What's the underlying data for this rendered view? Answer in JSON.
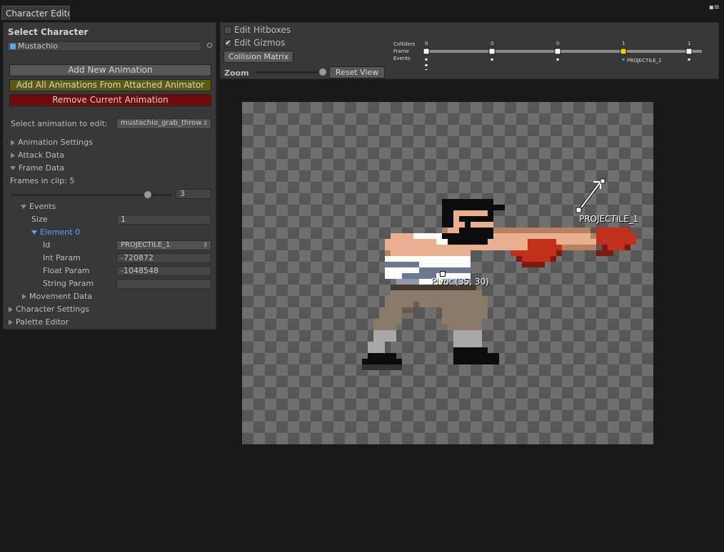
{
  "window": {
    "tab_label": "Character Edito",
    "menu_glyph": "▪≡"
  },
  "left": {
    "select_character_heading": "Select Character",
    "character_field": "Mustachio",
    "buttons": {
      "add_new": "Add New Animation",
      "add_all": "Add All Animations From Attached Animator",
      "remove": "Remove Current Animation"
    },
    "colors": {
      "add_all_bg": "#5a5a10",
      "remove_bg": "#6e0b0b"
    },
    "select_anim_label": "Select animation to edit:",
    "select_anim_value": "mustachio_grab_throw",
    "sections": {
      "animation_settings": "Animation Settings",
      "attack_data": "Attack Data",
      "frame_data": "Frame Data"
    },
    "frames_in_clip": "Frames in clip: 5",
    "frame_slider": {
      "value": "3",
      "fraction": 0.85
    },
    "events": {
      "label": "Events",
      "size_label": "Size",
      "size_value": "1",
      "element_label": "Element 0",
      "id_label": "Id",
      "id_value": "PROJECTILE_1",
      "int_label": "Int Param",
      "int_value": "-720872",
      "float_label": "Float Param",
      "float_value": "-1048548",
      "string_label": "String Param",
      "string_value": ""
    },
    "movement_data": "Movement Data",
    "character_settings": "Character Settings",
    "palette_editor": "Palette Editor"
  },
  "top": {
    "edit_hitboxes": "Edit Hitboxes",
    "edit_hitboxes_checked": false,
    "edit_gizmos": "Edit Gizmos",
    "edit_gizmos_checked": true,
    "collision_matrix": "Collision Matrix",
    "zoom_label": "Zoom",
    "zoom_fraction": 0.97,
    "reset_view": "Reset View",
    "timeline": {
      "row_labels": [
        "Colliders",
        "Frame",
        "Events"
      ],
      "collider_counts": [
        "0",
        "0",
        "0",
        "1",
        "1"
      ],
      "current_frame": 3,
      "event_label": "PROJECTILE_1",
      "event_color": "#2bb7e6",
      "current_color": "#f0d000"
    }
  },
  "canvas": {
    "projectile_label": "PROJECTILE_1",
    "pivot_label": "Pivot (35, 30)"
  }
}
